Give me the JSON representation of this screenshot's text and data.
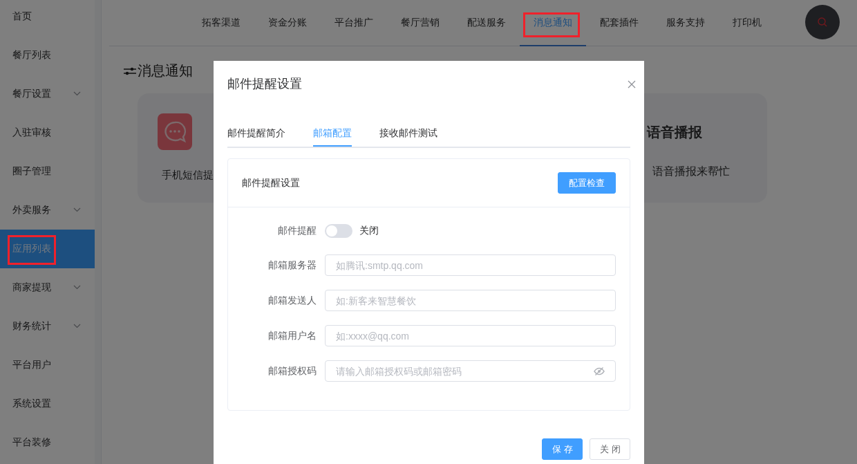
{
  "sidebar": {
    "items": [
      {
        "label": "首页",
        "selected": false,
        "has_submenu": false,
        "highlighted": false
      },
      {
        "label": "餐厅列表",
        "selected": false,
        "has_submenu": false,
        "highlighted": false
      },
      {
        "label": "餐厅设置",
        "selected": false,
        "has_submenu": true,
        "highlighted": false
      },
      {
        "label": "入驻审核",
        "selected": false,
        "has_submenu": false,
        "highlighted": false
      },
      {
        "label": "圈子管理",
        "selected": false,
        "has_submenu": false,
        "highlighted": false
      },
      {
        "label": "外卖服务",
        "selected": false,
        "has_submenu": true,
        "highlighted": false
      },
      {
        "label": "应用列表",
        "selected": true,
        "has_submenu": false,
        "highlighted": true
      },
      {
        "label": "商家提现",
        "selected": false,
        "has_submenu": true,
        "highlighted": false
      },
      {
        "label": "财务统计",
        "selected": false,
        "has_submenu": true,
        "highlighted": false
      },
      {
        "label": "平台用户",
        "selected": false,
        "has_submenu": false,
        "highlighted": false
      },
      {
        "label": "系统设置",
        "selected": false,
        "has_submenu": false,
        "highlighted": false
      },
      {
        "label": "平台装修",
        "selected": false,
        "has_submenu": false,
        "highlighted": false
      }
    ]
  },
  "top_nav": {
    "tabs": [
      {
        "label": "拓客渠道",
        "selected": false,
        "highlighted": false
      },
      {
        "label": "资金分账",
        "selected": false,
        "highlighted": false
      },
      {
        "label": "平台推广",
        "selected": false,
        "highlighted": false
      },
      {
        "label": "餐厅营销",
        "selected": false,
        "highlighted": false
      },
      {
        "label": "配送服务",
        "selected": false,
        "highlighted": false
      },
      {
        "label": "消息通知",
        "selected": true,
        "highlighted": true
      },
      {
        "label": "配套插件",
        "selected": false,
        "highlighted": false
      },
      {
        "label": "服务支持",
        "selected": false,
        "highlighted": false
      },
      {
        "label": "打印机",
        "selected": false,
        "highlighted": false
      }
    ]
  },
  "page": {
    "title": "消息通知",
    "cards": [
      {
        "kind": "sms",
        "description": "手机短信提"
      },
      {
        "kind": "voice",
        "title": "语音播报",
        "description": "语音播报来帮忙"
      }
    ]
  },
  "dialog": {
    "title": "邮件提醒设置",
    "tabs": [
      {
        "label": "邮件提醒简介",
        "selected": false
      },
      {
        "label": "邮箱配置",
        "selected": true
      },
      {
        "label": "接收邮件测试",
        "selected": false
      }
    ],
    "panel": {
      "title": "邮件提醒设置",
      "check_button": "配置检查",
      "fields": [
        {
          "kind": "switch",
          "label": "邮件提醒",
          "on": false,
          "state_text": "关闭"
        },
        {
          "kind": "input",
          "label": "邮箱服务器",
          "placeholder": "如腾讯:smtp.qq.com"
        },
        {
          "kind": "input",
          "label": "邮箱发送人",
          "placeholder": "如:新客来智慧餐饮"
        },
        {
          "kind": "input",
          "label": "邮箱用户名",
          "placeholder": "如:xxxx@qq.com"
        },
        {
          "kind": "password",
          "label": "邮箱授权码",
          "placeholder": "请输入邮箱授权码或邮箱密码"
        }
      ]
    },
    "buttons": [
      {
        "label": "保存",
        "kind": "primary"
      },
      {
        "label": "关闭",
        "kind": "default"
      }
    ]
  }
}
